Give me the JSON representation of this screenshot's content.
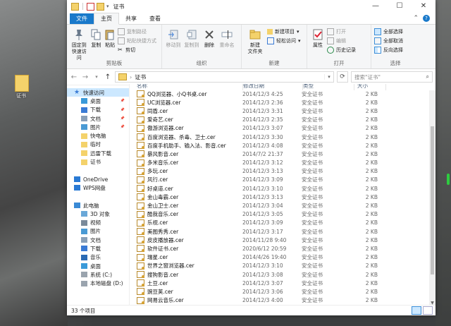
{
  "window": {
    "title": "证书",
    "controls": [
      "—",
      "☐",
      "✕"
    ]
  },
  "ribbon_tabs": [
    {
      "label": "文件"
    },
    {
      "label": "主页"
    },
    {
      "label": "共享"
    },
    {
      "label": "查看"
    }
  ],
  "ribbon": {
    "clipboard": {
      "pin": "固定到快速访问",
      "copy": "复制",
      "paste": "粘贴",
      "copy_path": "复制路径",
      "paste_shortcut": "粘贴快捷方式",
      "cut": "剪切",
      "name": "剪贴板"
    },
    "organize": {
      "move_to": "移动到",
      "copy_to": "复制到",
      "delete": "删除",
      "rename": "重命名",
      "name": "组织"
    },
    "new": {
      "new_folder": "新建\n文件夹",
      "new_item": "新建项目",
      "easy_access": "轻松访问",
      "name": "新建"
    },
    "open": {
      "properties": "属性",
      "open": "打开",
      "edit": "编辑",
      "history": "历史记录",
      "name": "打开"
    },
    "select": {
      "select_all": "全部选择",
      "select_none": "全部取消",
      "invert": "反向选择",
      "name": "选择"
    }
  },
  "address": {
    "path": "证书",
    "search_placeholder": "搜索\"证书\""
  },
  "nav": [
    {
      "label": "快速访问",
      "icon": "star-icon",
      "pinned": false,
      "sel": true,
      "indent": 0
    },
    {
      "label": "桌面",
      "icon": "desktop-icon",
      "pinned": true,
      "sel": false,
      "indent": 1
    },
    {
      "label": "下载",
      "icon": "download-icon",
      "pinned": true,
      "sel": false,
      "indent": 1
    },
    {
      "label": "文档",
      "icon": "document-icon",
      "pinned": true,
      "sel": false,
      "indent": 1
    },
    {
      "label": "图片",
      "icon": "pictures-icon",
      "pinned": true,
      "sel": false,
      "indent": 1
    },
    {
      "label": "快电脑",
      "icon": "folder-icon",
      "pinned": false,
      "sel": false,
      "indent": 1
    },
    {
      "label": "临时",
      "icon": "folder-icon",
      "pinned": false,
      "sel": false,
      "indent": 1
    },
    {
      "label": "迅雷下载",
      "icon": "folder-icon",
      "pinned": false,
      "sel": false,
      "indent": 1
    },
    {
      "label": "证书",
      "icon": "folder-icon",
      "pinned": false,
      "sel": false,
      "indent": 1
    },
    {
      "label": "",
      "icon": "",
      "pinned": false,
      "sel": false,
      "indent": 0
    },
    {
      "label": "OneDrive",
      "icon": "cloud-icon",
      "pinned": false,
      "sel": false,
      "indent": 0
    },
    {
      "label": "WPS网盘",
      "icon": "cloud-icon",
      "pinned": false,
      "sel": false,
      "indent": 0
    },
    {
      "label": "",
      "icon": "",
      "pinned": false,
      "sel": false,
      "indent": 0
    },
    {
      "label": "此电脑",
      "icon": "computer-icon",
      "pinned": false,
      "sel": false,
      "indent": 0
    },
    {
      "label": "3D 对象",
      "icon": "cube-icon",
      "pinned": false,
      "sel": false,
      "indent": 1
    },
    {
      "label": "视频",
      "icon": "video-icon",
      "pinned": false,
      "sel": false,
      "indent": 1
    },
    {
      "label": "图片",
      "icon": "pictures-icon",
      "pinned": false,
      "sel": false,
      "indent": 1
    },
    {
      "label": "文档",
      "icon": "document-icon",
      "pinned": false,
      "sel": false,
      "indent": 1
    },
    {
      "label": "下载",
      "icon": "download-icon",
      "pinned": false,
      "sel": false,
      "indent": 1
    },
    {
      "label": "音乐",
      "icon": "music-icon",
      "pinned": false,
      "sel": false,
      "indent": 1
    },
    {
      "label": "桌面",
      "icon": "desktop-icon",
      "pinned": false,
      "sel": false,
      "indent": 1
    },
    {
      "label": "系统 (C:)",
      "icon": "drive-icon",
      "pinned": false,
      "sel": false,
      "indent": 1
    },
    {
      "label": "本地磁盘 (D:)",
      "icon": "drive-icon",
      "pinned": false,
      "sel": false,
      "indent": 1
    }
  ],
  "columns": {
    "name": "名称",
    "date": "修改日期",
    "type": "类型",
    "size": "大小"
  },
  "files": [
    {
      "name": "QQ浏览器、小Q书桌.cer",
      "date": "2014/12/3 4:25",
      "type": "安全证书",
      "size": "2 KB"
    },
    {
      "name": "UC浏览器.cer",
      "date": "2014/12/3 2:36",
      "type": "安全证书",
      "size": "2 KB"
    },
    {
      "name": "同盾.cer",
      "date": "2014/12/3 3:31",
      "type": "安全证书",
      "size": "2 KB"
    },
    {
      "name": "爱奇艺.cer",
      "date": "2014/12/3 2:35",
      "type": "安全证书",
      "size": "2 KB"
    },
    {
      "name": "傲游浏览器.cer",
      "date": "2014/12/3 3:07",
      "type": "安全证书",
      "size": "2 KB"
    },
    {
      "name": "百度浏览器、杀毒、卫士.cer",
      "date": "2014/12/3 3:30",
      "type": "安全证书",
      "size": "2 KB"
    },
    {
      "name": "百度手机助手、输入法、影音.cer",
      "date": "2014/12/3 4:08",
      "type": "安全证书",
      "size": "2 KB"
    },
    {
      "name": "暴风影音.cer",
      "date": "2014/7/2 21:37",
      "type": "安全证书",
      "size": "2 KB"
    },
    {
      "name": "多米音乐.cer",
      "date": "2014/12/3 3:12",
      "type": "安全证书",
      "size": "2 KB"
    },
    {
      "name": "多玩.cer",
      "date": "2014/12/3 3:13",
      "type": "安全证书",
      "size": "2 KB"
    },
    {
      "name": "风行.cer",
      "date": "2014/12/3 3:09",
      "type": "安全证书",
      "size": "2 KB"
    },
    {
      "name": "好桌道.cer",
      "date": "2014/12/3 3:10",
      "type": "安全证书",
      "size": "2 KB"
    },
    {
      "name": "金山毒霸.cer",
      "date": "2014/12/3 3:13",
      "type": "安全证书",
      "size": "2 KB"
    },
    {
      "name": "金山卫士.cer",
      "date": "2014/12/3 3:04",
      "type": "安全证书",
      "size": "2 KB"
    },
    {
      "name": "酷我音乐.cer",
      "date": "2014/12/3 3:05",
      "type": "安全证书",
      "size": "2 KB"
    },
    {
      "name": "乐视.cer",
      "date": "2014/12/3 3:09",
      "type": "安全证书",
      "size": "2 KB"
    },
    {
      "name": "美图秀秀.cer",
      "date": "2014/12/3 3:17",
      "type": "安全证书",
      "size": "2 KB"
    },
    {
      "name": "皮皮播放器.cer",
      "date": "2014/11/28 9:40",
      "type": "安全证书",
      "size": "2 KB"
    },
    {
      "name": "软件证书.cer",
      "date": "2020/6/12 20:59",
      "type": "安全证书",
      "size": "2 KB"
    },
    {
      "name": "瑞星.cer",
      "date": "2014/4/26 19:40",
      "type": "安全证书",
      "size": "2 KB"
    },
    {
      "name": "世界之窗浏览器.cer",
      "date": "2014/12/3 3:10",
      "type": "安全证书",
      "size": "2 KB"
    },
    {
      "name": "搜狗影音.cer",
      "date": "2014/12/3 3:08",
      "type": "安全证书",
      "size": "2 KB"
    },
    {
      "name": "土豆.cer",
      "date": "2014/12/3 3:07",
      "type": "安全证书",
      "size": "2 KB"
    },
    {
      "name": "豌豆荚.cer",
      "date": "2014/12/3 3:06",
      "type": "安全证书",
      "size": "2 KB"
    },
    {
      "name": "网易云音乐.cer",
      "date": "2014/12/3 4:00",
      "type": "安全证书",
      "size": "2 KB"
    }
  ],
  "status": {
    "count": "33 个项目"
  },
  "desktop": {
    "icon_label": "证书"
  },
  "colors": {
    "accent": "#1979ca",
    "folder": "#f4d26b",
    "selection": "#cce8ff"
  }
}
